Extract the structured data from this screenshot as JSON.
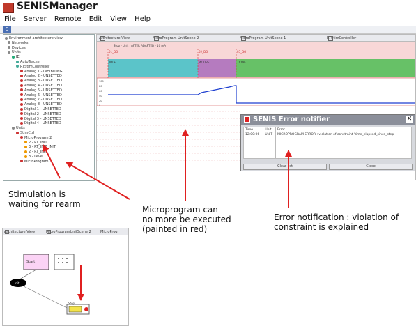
{
  "window": {
    "title": "SENISManager"
  },
  "menu": [
    "File",
    "Server",
    "Remote",
    "Edit",
    "View",
    "Help"
  ],
  "toolbar": {
    "button": "S"
  },
  "tree": [
    {
      "text": "Environment architecture view",
      "dot": "#888"
    },
    {
      "text": "Networks",
      "dot": "#888"
    },
    {
      "text": "Devices",
      "dot": "#888"
    },
    {
      "text": "Units",
      "dot": "#888"
    },
    {
      "text": "IE",
      "dot": "#2a7"
    },
    {
      "text": "AutoTracker",
      "dot": "#4a9"
    },
    {
      "text": "RTStimController",
      "dot": "#4a9"
    },
    {
      "text": "Analog 1 - INHIBITING",
      "dot": "#c33"
    },
    {
      "text": "Analog 2 - UNSETTED",
      "dot": "#c33"
    },
    {
      "text": "Analog 3 - UNSETTED",
      "dot": "#c33"
    },
    {
      "text": "Analog 4 - UNSETTED",
      "dot": "#c33"
    },
    {
      "text": "Analog 5 - UNSETTED",
      "dot": "#c33"
    },
    {
      "text": "Analog 6 - UNSETTED",
      "dot": "#c33"
    },
    {
      "text": "Analog 7 - UNSETTED",
      "dot": "#c33"
    },
    {
      "text": "Analog 8 - UNSETTED",
      "dot": "#c33"
    },
    {
      "text": "Digital 1 - UNSETTED",
      "dot": "#c33"
    },
    {
      "text": "Digital 2 - UNSETTED",
      "dot": "#c33"
    },
    {
      "text": "Digital 3 - UNSETTED",
      "dot": "#c33"
    },
    {
      "text": "Digital 4 - UNSETTED",
      "dot": "#c33"
    },
    {
      "text": "Units",
      "dot": "#888"
    },
    {
      "text": "StimCtrl",
      "dot": "#c33"
    },
    {
      "text": "MicroProgram 2",
      "dot": "#c33"
    },
    {
      "text": "2 - RT_INIT",
      "dot": "#e90"
    },
    {
      "text": "3 - RT_INIT_INIT",
      "dot": "#e90"
    },
    {
      "text": "2 - RT_INIT",
      "dot": "#e90"
    },
    {
      "text": "3 - Level",
      "dot": "#e90"
    },
    {
      "text": "MicroProgram 1",
      "dot": "#c33"
    }
  ],
  "tabs": [
    "Architecture View",
    "MicroProgram UnitScene 2",
    "MicroProgram UnitScene 1",
    "RTStimController"
  ],
  "chart": {
    "header": "Stop - Unit : AFTER ADAPTED - 10 mA",
    "segments": [
      {
        "label": "IDLE",
        "color": "#5bc4c9"
      },
      {
        "label": "ACTIVE",
        "color": "#b57bbf"
      },
      {
        "label": "DONE",
        "color": "#67c167"
      }
    ],
    "markers": [
      "01_DO",
      "02_DO",
      "03_DO"
    ],
    "yticks": [
      "100",
      "80",
      "60",
      "40",
      "20",
      "0"
    ]
  },
  "error": {
    "title": "SENIS Error notifier",
    "columns": [
      "Time",
      "Unit",
      "Error"
    ],
    "rows": [
      [
        "12:00:06",
        "UNIT",
        "MICROPROGRAM ERROR : violation of constraint 'time_elapsed_since_step'"
      ]
    ],
    "clear_label": "Clear list",
    "close_label": "Close"
  },
  "annotations": {
    "stimulation": "Stimulation is\nwaiting for rearm",
    "microprogram": "Microprogram can\nno more be executed\n(painted in red)",
    "error": "Error notification : violation of\nconstraint is explained"
  },
  "bottom_tabs": [
    "Architecture View",
    "MicroProgramUnitScene 2",
    "MicroProg"
  ],
  "bottom_nodes": {
    "top": "Start",
    "mid": "Init",
    "end": "Stop"
  },
  "colors": {
    "error_red": "#e02020",
    "segment_red": "#f8d7d7",
    "accent": "#4a6fb3"
  }
}
